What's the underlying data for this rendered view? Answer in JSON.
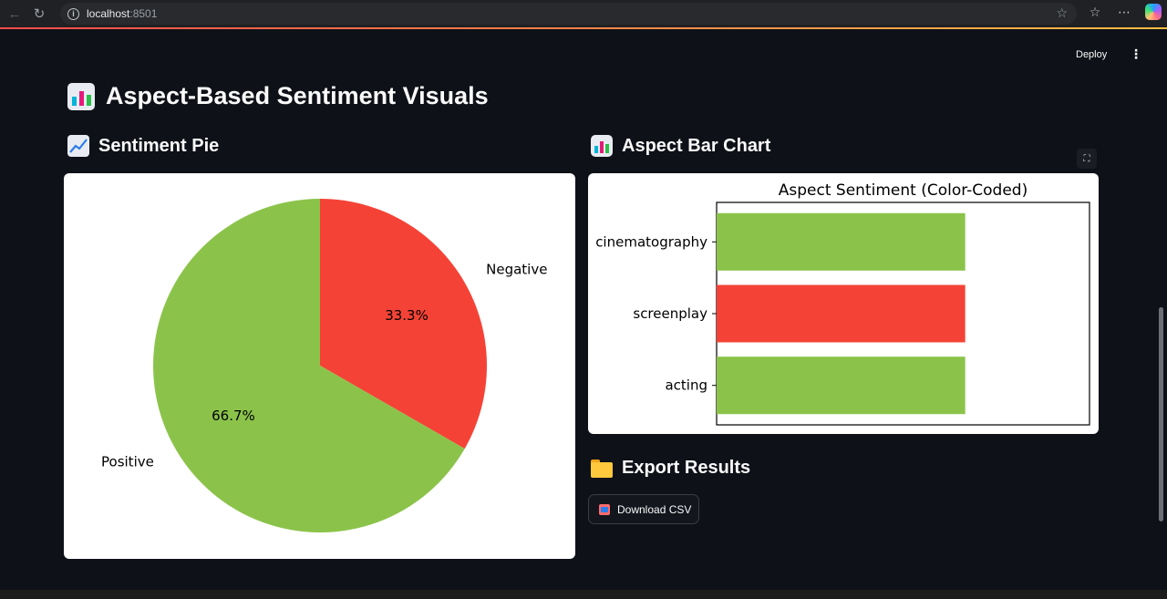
{
  "browser": {
    "url_host": "localhost",
    "url_port": ":8501"
  },
  "app": {
    "deploy_label": "Deploy",
    "menu_label": "⋮",
    "title": "Aspect-Based Sentiment Visuals",
    "pie_section_title": "Sentiment Pie",
    "bar_section_title": "Aspect Bar Chart",
    "export_title": "Export Results",
    "download_label": "Download CSV"
  },
  "colors": {
    "positive": "#8bc34a",
    "negative": "#f44336",
    "background": "#0e1117"
  },
  "chart_data": [
    {
      "type": "pie",
      "labels": [
        "Negative",
        "Positive"
      ],
      "values": [
        33.3,
        66.7
      ],
      "value_labels": [
        "33.3%",
        "66.7%"
      ],
      "colors": [
        "#f44336",
        "#8bc34a"
      ]
    },
    {
      "type": "bar",
      "orientation": "horizontal",
      "title": "Aspect Sentiment (Color-Coded)",
      "categories": [
        "cinematography",
        "screenplay",
        "acting"
      ],
      "values": [
        1,
        1,
        1
      ],
      "colors": [
        "#8bc34a",
        "#f44336",
        "#8bc34a"
      ],
      "xlim": [
        0,
        1.5
      ]
    }
  ]
}
